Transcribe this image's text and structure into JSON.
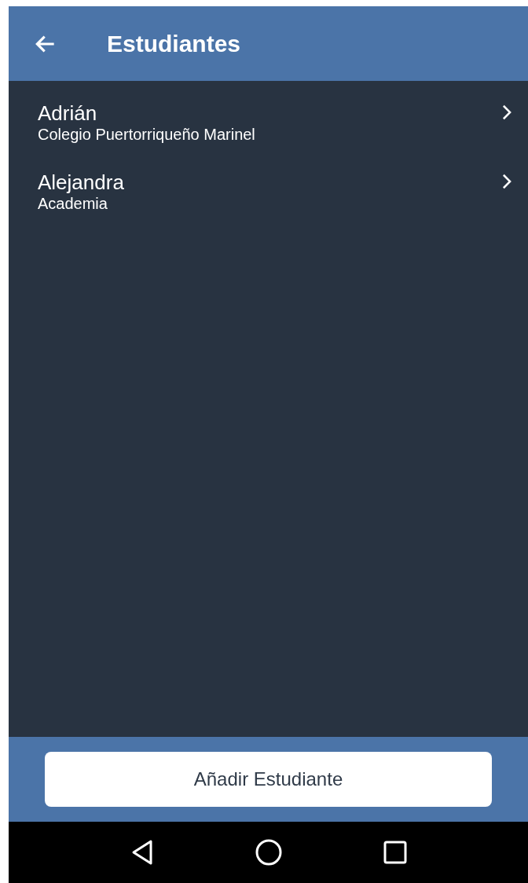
{
  "app_bar": {
    "title": "Estudiantes"
  },
  "students": [
    {
      "name": "Adrián",
      "school": "Colegio Puertorriqueño Marinel"
    },
    {
      "name": "Alejandra",
      "school": "Academia"
    }
  ],
  "footer": {
    "button": "Añadir Estudiante"
  }
}
